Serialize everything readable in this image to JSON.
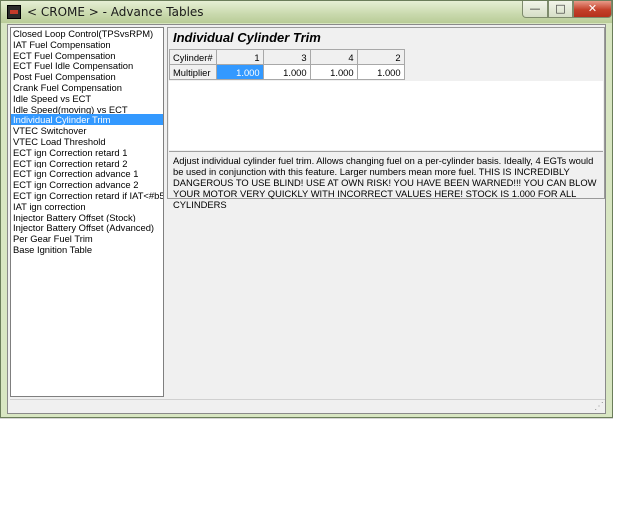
{
  "window": {
    "title": "< CROME > - Advance Tables",
    "min_label": "—",
    "max_label": "□",
    "close_label": "✕"
  },
  "table_list": {
    "items": [
      "Closed Loop Control(TPSvsRPM)",
      "IAT Fuel Compensation",
      "ECT Fuel Compensation",
      "ECT Fuel Idle Compensation",
      "Post Fuel Compensation",
      "Crank Fuel Compensation",
      "Idle Speed vs ECT",
      "Idle Speed(moving) vs ECT",
      "Individual Cylinder Trim",
      "VTEC Switchover",
      "VTEC Load Threshold",
      "ECT ign Correction retard 1",
      "ECT ign Correction retard 2",
      "ECT ign Correction advance 1",
      "ECT ign Correction advance 2",
      "ECT ign Correction retard if IAT<#b5h",
      "IAT ign correction",
      "Injector Battery Offset (Stock)",
      "Injector Battery Offset (Advanced)",
      "Per Gear Fuel Trim",
      "Base Ignition Table"
    ],
    "selected_index": 8
  },
  "editor": {
    "heading": "Individual Cylinder Trim",
    "row_header_cylinder": "Cylinder#",
    "row_header_multiplier": "Multiplier",
    "cylinders": [
      "1",
      "3",
      "4",
      "2"
    ],
    "multipliers": [
      "1.000",
      "1.000",
      "1.000",
      "1.000"
    ],
    "selected_cell": 0,
    "description": "Adjust individual cylinder fuel trim.  Allows changing fuel on a per-cylinder basis.  Ideally, 4 EGTs would be used in conjunction with this feature.  Larger numbers mean more fuel.  THIS IS INCREDIBLY DANGEROUS TO USE BLIND!  USE AT OWN RISK!  YOU HAVE BEEN WARNED!!!  YOU CAN BLOW YOUR MOTOR VERY QUICKLY WITH INCORRECT VALUES HERE!  STOCK IS 1.000 FOR ALL CYLINDERS"
  }
}
